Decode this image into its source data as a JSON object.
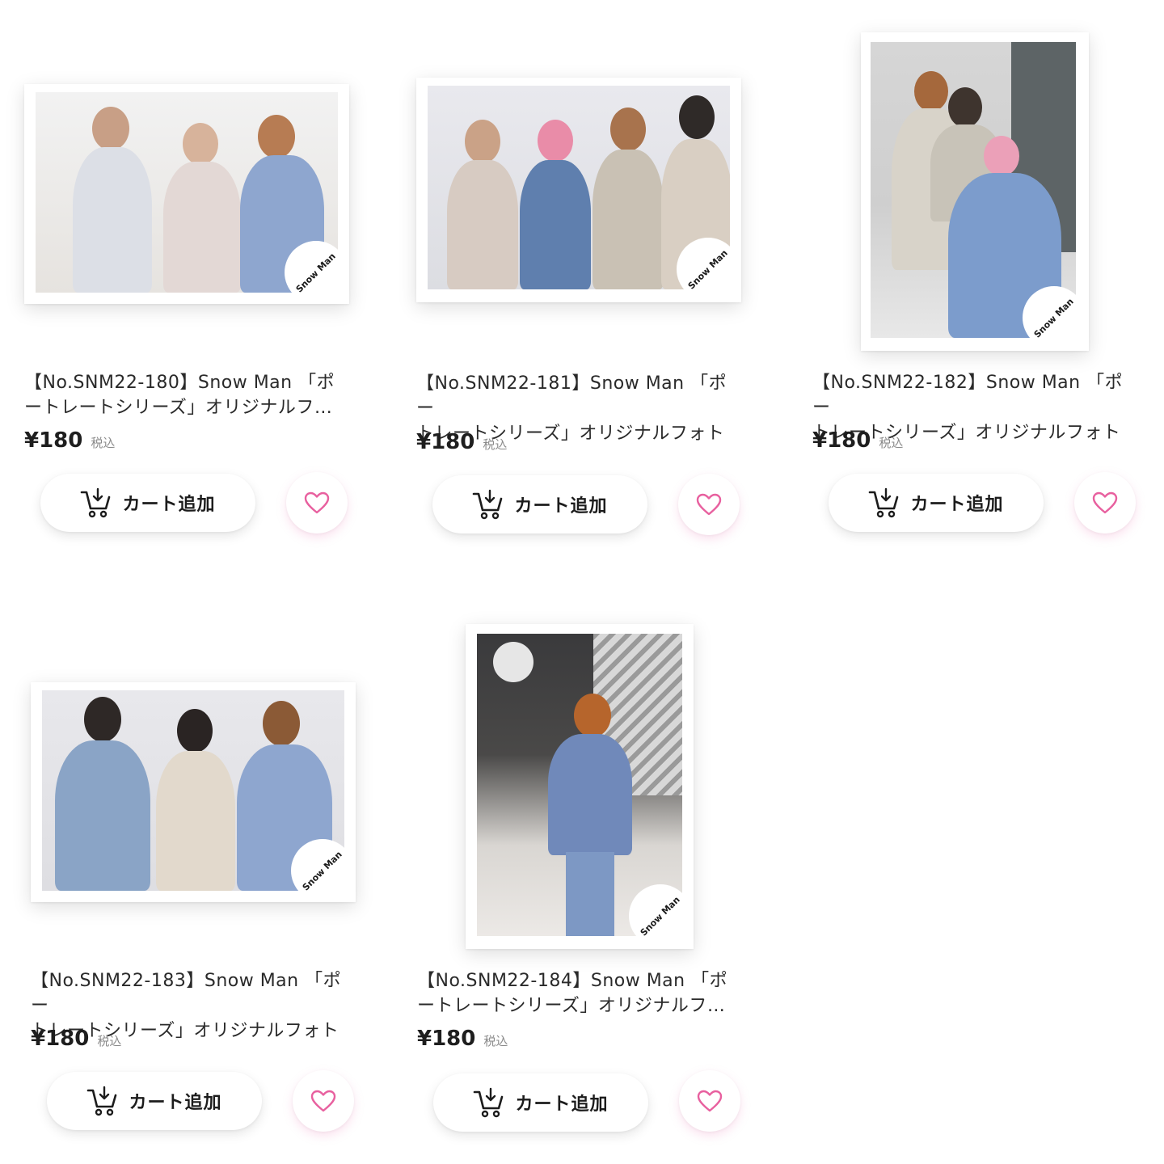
{
  "products": [
    {
      "title_line1": "【No.SNM22-180】Snow Man 「ポ",
      "title_line2": "ートレートシリーズ」オリジナルフ…",
      "price": "¥180",
      "tax_label": "税込",
      "cart_label": "カート追加",
      "logo_text": "Snow Man"
    },
    {
      "title_line1": "【No.SNM22-181】Snow Man 「ポー",
      "title_line2": "トレートシリーズ」オリジナルフォト",
      "price": "¥180",
      "tax_label": "税込",
      "cart_label": "カート追加",
      "logo_text": "Snow Man"
    },
    {
      "title_line1": "【No.SNM22-182】Snow Man 「ポー",
      "title_line2": "トレートシリーズ」オリジナルフォト",
      "price": "¥180",
      "tax_label": "税込",
      "cart_label": "カート追加",
      "logo_text": "Snow Man"
    },
    {
      "title_line1": "【No.SNM22-183】Snow Man 「ポー",
      "title_line2": "トレートシリーズ」オリジナルフォト",
      "price": "¥180",
      "tax_label": "税込",
      "cart_label": "カート追加",
      "logo_text": "Snow Man"
    },
    {
      "title_line1": "【No.SNM22-184】Snow Man 「ポ",
      "title_line2": "ートレートシリーズ」オリジナルフ…",
      "price": "¥180",
      "tax_label": "税込",
      "cart_label": "カート追加",
      "logo_text": "Snow Man"
    }
  ],
  "icons": {
    "cart": "cart-download-icon",
    "favorite": "heart-icon"
  },
  "colors": {
    "heart": "#e8609f",
    "button_bg": "#ffffff",
    "text": "#222222",
    "tax": "#8a8a8a"
  }
}
